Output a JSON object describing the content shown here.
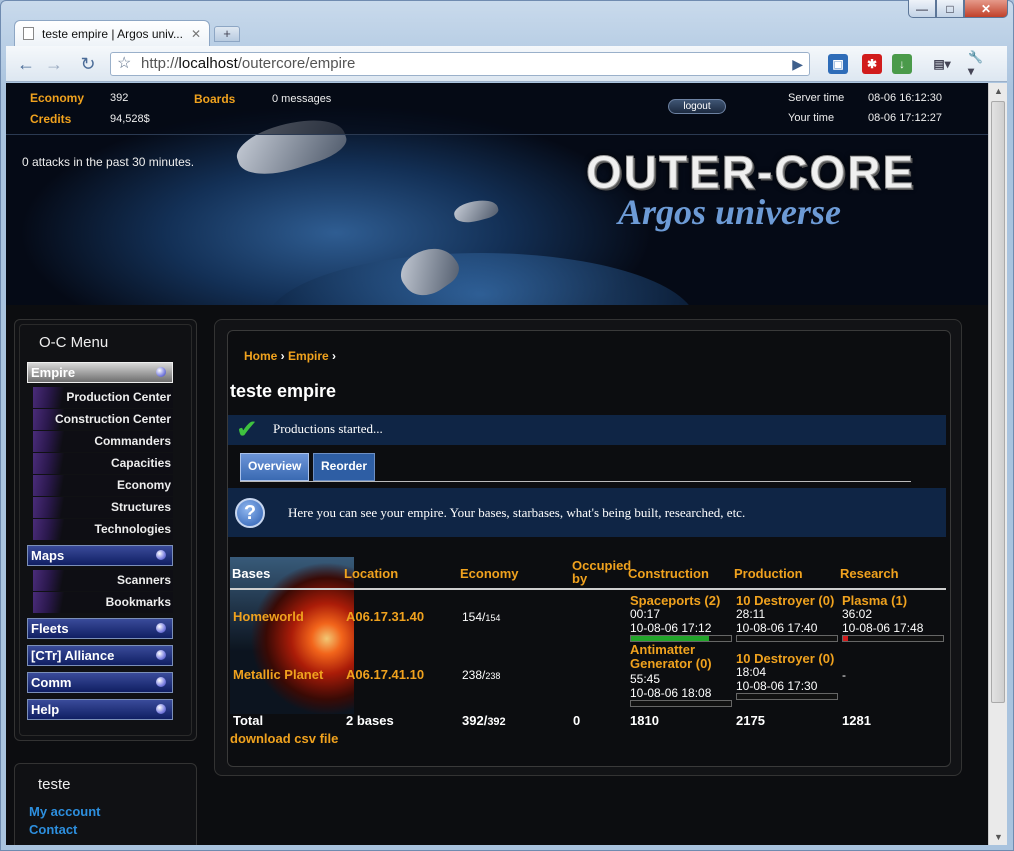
{
  "browser": {
    "tab_title": "teste empire | Argos univ...",
    "url_prefix": "http://",
    "url_host": "localhost",
    "url_path": "/outercore/empire"
  },
  "stats": {
    "economy_label": "Economy",
    "economy_value": "392",
    "credits_label": "Credits",
    "credits_value": "94,528$",
    "boards_label": "Boards",
    "boards_value": "0 messages",
    "logout": "logout",
    "server_time_label": "Server time",
    "server_time_value": "08-06 16:12:30",
    "your_time_label": "Your time",
    "your_time_value": "08-06 17:12:27"
  },
  "banner": {
    "attacks": "0 attacks in the past 30 minutes.",
    "brand_title": "OUTER-CORE",
    "brand_sub": "Argos universe"
  },
  "menu": {
    "title": "O-C Menu",
    "empire": "Empire",
    "production_center": "Production Center",
    "construction_center": "Construction Center",
    "commanders": "Commanders",
    "capacities": "Capacities",
    "economy": "Economy",
    "structures": "Structures",
    "technologies": "Technologies",
    "maps": "Maps",
    "scanners": "Scanners",
    "bookmarks": "Bookmarks",
    "fleets": "Fleets",
    "alliance": "[CTr] Alliance",
    "comm": "Comm",
    "help": "Help"
  },
  "user": {
    "name": "teste",
    "my_account": "My account",
    "contact": "Contact"
  },
  "content": {
    "crumb_home": "Home",
    "crumb_empire": "Empire",
    "title": "teste empire",
    "notice": "Productions started...",
    "tab_overview": "Overview",
    "tab_reorder": "Reorder",
    "info": "Here you can see your empire. Your bases, starbases, what's being built, researched, etc."
  },
  "table": {
    "headers": {
      "bases": "Bases",
      "location": "Location",
      "economy": "Economy",
      "occupied_1": "Occupied",
      "occupied_2": "by",
      "construction": "Construction",
      "production": "Production",
      "research": "Research"
    },
    "rows": [
      {
        "base": "Homeworld",
        "location": "A06.17.31.40",
        "econ_main": "154/",
        "econ_small": "154",
        "construction": {
          "name": "Spaceports (2)",
          "time": "00:17",
          "date": "10-08-06 17:12",
          "progress": 0.78
        },
        "production": {
          "name": "10 Destroyer (0)",
          "time": "28:11",
          "date": "10-08-06 17:40",
          "progress": 0.0
        },
        "research": {
          "name": "Plasma (1)",
          "time": "36:02",
          "date": "10-08-06 17:48",
          "progress": 0.05
        }
      },
      {
        "base": "Metallic Planet",
        "location": "A06.17.41.10",
        "econ_main": "238/",
        "econ_small": "238",
        "construction": {
          "name_1": "Antimatter",
          "name_2": "Generator (0)",
          "time": "55:45",
          "date": "10-08-06 18:08",
          "progress": 0.0
        },
        "production": {
          "name": "10 Destroyer (0)",
          "time": "18:04",
          "date": "10-08-06 17:30",
          "progress": 0.0
        },
        "research": {
          "name": "-"
        }
      }
    ],
    "total": {
      "label": "Total",
      "bases": "2 bases",
      "econ_main": "392/",
      "econ_small": "392",
      "occupied": "0",
      "construction": "1810",
      "production": "2175",
      "research": "1281"
    },
    "csv": "download csv file"
  },
  "colors": {
    "accent_orange": "#f0a21e",
    "progress_green": "#22a52a",
    "progress_red": "#d11c1c"
  }
}
